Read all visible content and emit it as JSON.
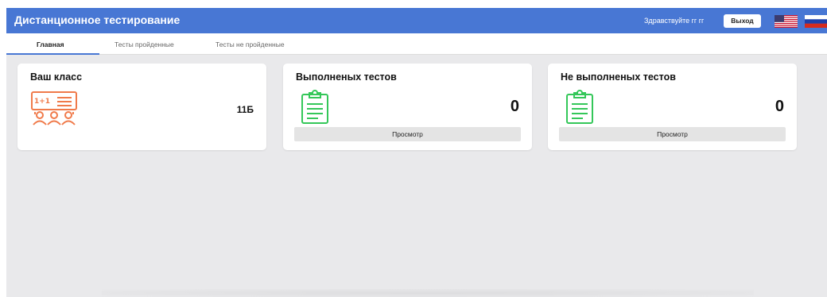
{
  "header": {
    "title": "Дистанционное тестирование",
    "greeting": "Здравствуйте гг гг",
    "logout_label": "Выход",
    "flags": [
      "flag-us-icon",
      "flag-ru-icon"
    ],
    "accent_color": "#4877d4"
  },
  "tabs": [
    {
      "label": "Главная",
      "active": true
    },
    {
      "label": "Тесты пройденные",
      "active": false
    },
    {
      "label": "Тесты не пройденные",
      "active": false
    }
  ],
  "cards": [
    {
      "title": "Ваш класс",
      "value": "11Б",
      "icon": "class-icon",
      "icon_color": "#f07a4a"
    },
    {
      "title": "Выполненых тестов",
      "value": "0",
      "icon": "clipboard-icon",
      "icon_color": "#34c759",
      "button_label": "Просмотр"
    },
    {
      "title": "Не выполненых тестов",
      "value": "0",
      "icon": "clipboard-icon",
      "icon_color": "#34c759",
      "button_label": "Просмотр"
    }
  ]
}
